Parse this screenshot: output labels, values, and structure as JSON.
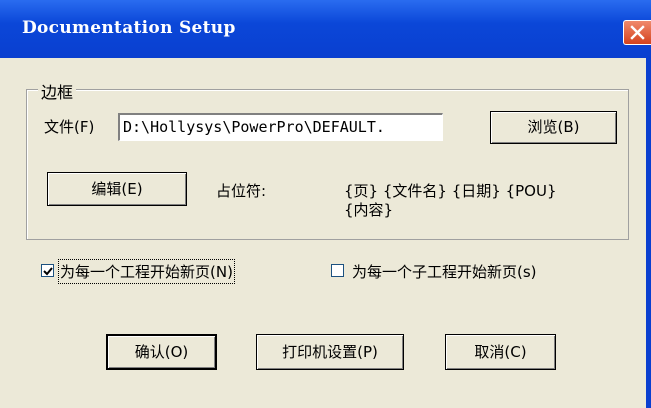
{
  "window": {
    "title": "Documentation Setup"
  },
  "group": {
    "label": "边框"
  },
  "file": {
    "label": "文件(F)",
    "value": "D:\\Hollysys\\PowerPro\\DEFAULT."
  },
  "buttons": {
    "browse": "浏览(B)",
    "edit": "编辑(E)",
    "ok": "确认(O)",
    "printer_setup": "打印机设置(P)",
    "cancel": "取消(C)"
  },
  "placeholders": {
    "label": "占位符:",
    "line1": "{页}  {文件名}  {日期}  {POU}",
    "line2": "{内容}"
  },
  "options": {
    "new_page_per_project": {
      "label": "为每一个工程开始新页(N)",
      "checked": true
    },
    "new_page_per_subproject": {
      "label": "为每一个子工程开始新页(s)",
      "checked": false
    }
  }
}
